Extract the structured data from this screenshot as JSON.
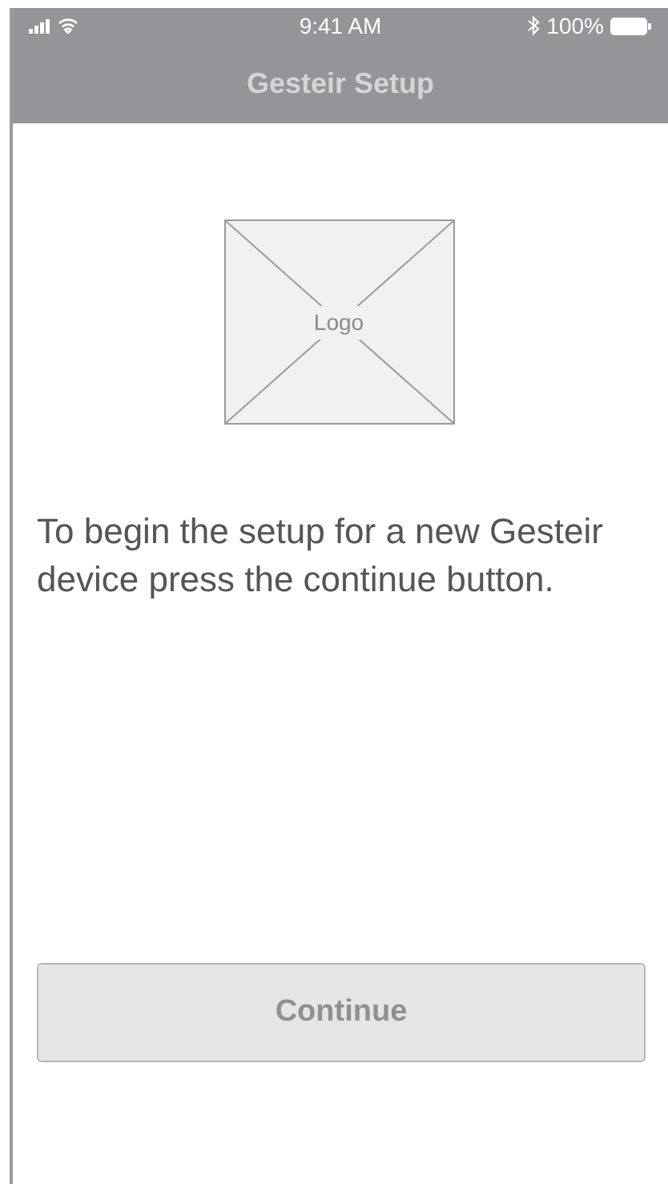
{
  "status_bar": {
    "time": "9:41 AM",
    "battery": "100%"
  },
  "nav_bar": {
    "title": "Gesteir Setup"
  },
  "logo": {
    "label": "Logo"
  },
  "message": "To begin the setup for a new Gesteir device press the continue button.",
  "button": {
    "label": "Continue"
  }
}
